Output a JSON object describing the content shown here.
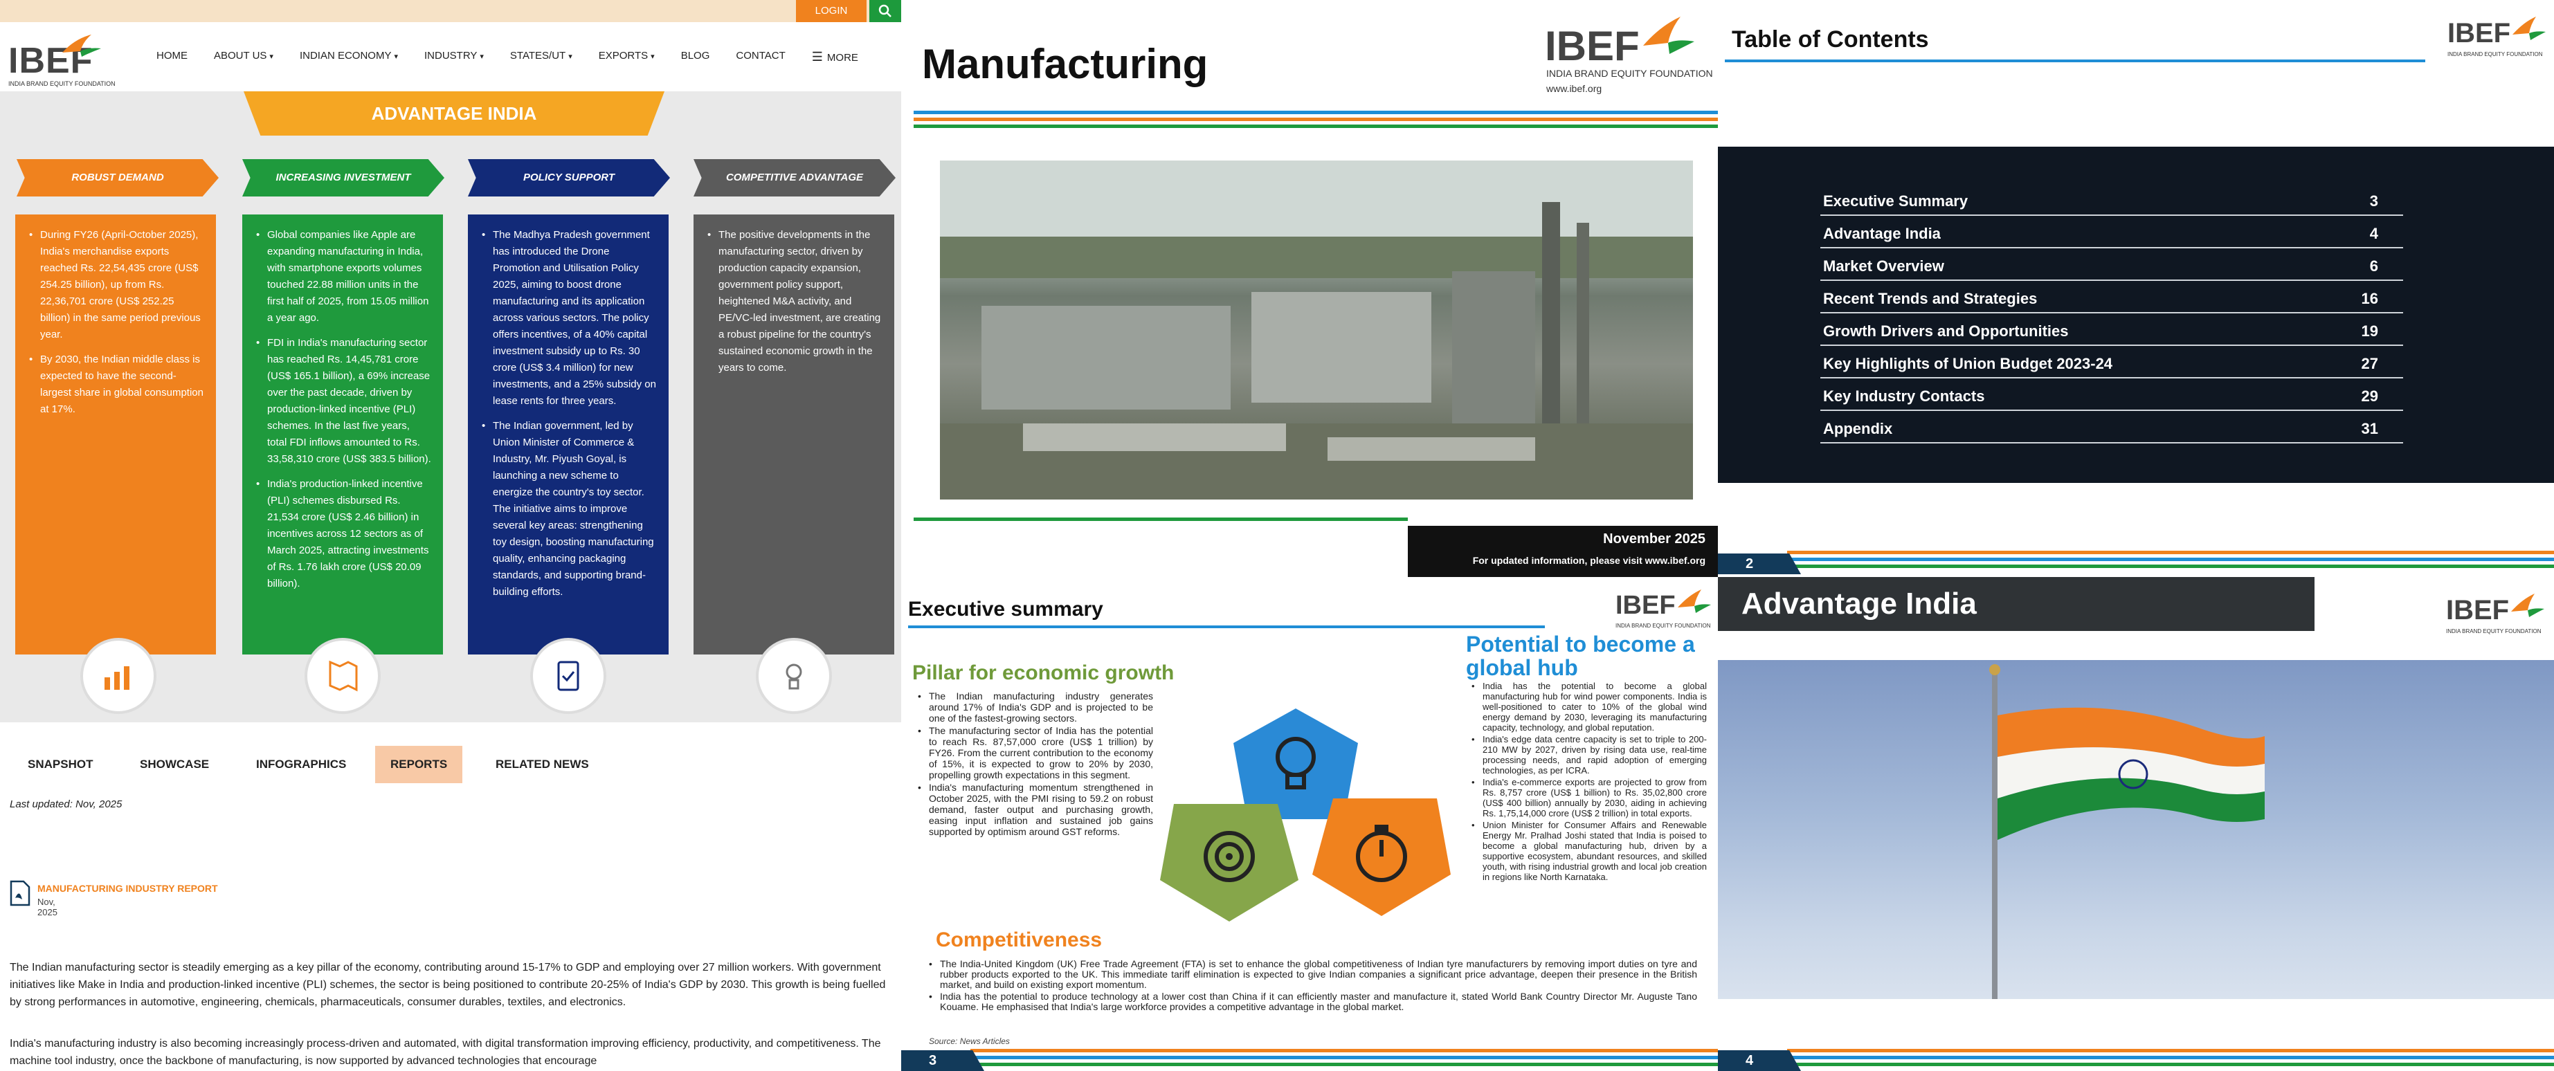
{
  "web": {
    "login_label": "LOGIN",
    "logo_word": "IBEF",
    "logo_sub": "INDIA BRAND EQUITY FOUNDATION",
    "nav": [
      "HOME",
      "ABOUT US",
      "INDIAN ECONOMY",
      "INDUSTRY",
      "STATES/UT",
      "EXPORTS",
      "BLOG",
      "CONTACT",
      "MORE"
    ],
    "banner": "ADVANTAGE INDIA",
    "columns": [
      {
        "tag": "ROBUST DEMAND",
        "color": "#f0821e",
        "bullets": [
          "During FY26 (April-October 2025), India's merchandise exports reached Rs. 22,54,435 crore (US$ 254.25 billion), up from Rs. 22,36,701 crore (US$ 252.25 billion) in the same period previous year.",
          "By 2030, the Indian middle class is expected to have the second-largest share in global consumption at 17%."
        ]
      },
      {
        "tag": "INCREASING INVESTMENT",
        "color": "#1f9a3d",
        "bullets": [
          "Global companies like Apple are expanding manufacturing in India, with smartphone exports volumes touched 22.88 million units in the first half of 2025, from 15.05 million a year ago.",
          "FDI in India's manufacturing sector has reached Rs. 14,45,781 crore (US$ 165.1 billion), a 69% increase over the past decade, driven by production-linked incentive (PLI) schemes. In the last five years, total FDI inflows amounted to Rs. 33,58,310 crore (US$ 383.5 billion).",
          "India's production-linked incentive (PLI) schemes disbursed Rs. 21,534 crore (US$ 2.46 billion) in incentives across 12 sectors as of March 2025, attracting investments of Rs. 1.76 lakh crore (US$ 20.09 billion)."
        ]
      },
      {
        "tag": "POLICY SUPPORT",
        "color": "#122a78",
        "bullets": [
          "The Madhya Pradesh government has introduced the Drone Promotion and Utilisation Policy 2025, aiming to boost drone manufacturing and its application across various sectors. The policy offers incentives, of a 40% capital investment subsidy up to Rs. 30 crore (US$ 3.4 million) for new investments, and a 25% subsidy on lease rents for three years.",
          "The Indian government, led by Union Minister of Commerce & Industry, Mr. Piyush Goyal, is launching a new scheme to energize the country's toy sector. The initiative aims to improve several key areas: strengthening toy design, boosting manufacturing quality, enhancing packaging standards, and supporting brand-building efforts."
        ]
      },
      {
        "tag": "COMPETITIVE ADVANTAGE",
        "color": "#5b5b5b",
        "bullets": [
          "The positive developments in the manufacturing sector, driven by production capacity expansion, government policy support, heightened M&A activity, and PE/VC-led investment, are creating a robust pipeline for the country's sustained economic growth in the years to come."
        ]
      }
    ],
    "tabs": [
      "SNAPSHOT",
      "SHOWCASE",
      "INFOGRAPHICS",
      "REPORTS",
      "RELATED NEWS"
    ],
    "active_tab": "REPORTS",
    "last_updated": "Last updated: Nov, 2025",
    "report_title": "MANUFACTURING INDUSTRY REPORT",
    "report_date": "Nov, 2025",
    "para1": "The Indian manufacturing sector is steadily emerging as a key pillar of the economy, contributing around 15-17% to GDP and employing over 27 million workers. With government initiatives like Make in India and production-linked incentive (PLI) schemes, the sector is being positioned to contribute 20-25% of India's GDP by 2030. This growth is being fuelled by strong performances in automotive, engineering, chemicals, pharmaceuticals, consumer durables, textiles, and electronics.",
    "para2": "India's manufacturing industry is also becoming increasingly process-driven and automated, with digital transformation improving efficiency, productivity, and competitiveness. The machine tool industry, once the backbone of manufacturing, is now supported by advanced technologies that encourage"
  },
  "slide1": {
    "title": "Manufacturing",
    "logo_word": "IBEF",
    "logo_sub": "INDIA BRAND EQUITY FOUNDATION",
    "logo_url": "www.ibef.org",
    "date": "November 2025",
    "updated": "For updated information, please visit www.ibef.org"
  },
  "slide2": {
    "title": "Table of Contents",
    "logo_word": "IBEF",
    "logo_sub": "INDIA BRAND EQUITY FOUNDATION",
    "toc": [
      {
        "label": "Executive Summary",
        "page": "3"
      },
      {
        "label": "Advantage India",
        "page": "4"
      },
      {
        "label": "Market Overview",
        "page": "6"
      },
      {
        "label": "Recent Trends and Strategies",
        "page": "16"
      },
      {
        "label": "Growth Drivers and Opportunities",
        "page": "19"
      },
      {
        "label": "Key Highlights of Union Budget 2023-24",
        "page": "27"
      },
      {
        "label": "Key Industry Contacts",
        "page": "29"
      },
      {
        "label": "Appendix",
        "page": "31"
      }
    ],
    "page_num": "2"
  },
  "slide3": {
    "title": "Executive summary",
    "logo_word": "IBEF",
    "logo_sub": "INDIA BRAND EQUITY FOUNDATION",
    "h_green": "Pillar for economic growth",
    "h_blue": "Potential to become a global hub",
    "h_orange": "Competitiveness",
    "green_bullets": [
      "The Indian manufacturing industry generates around 17% of India's GDP and is projected to be one of the fastest-growing sectors.",
      "The manufacturing sector of India has the potential to reach Rs. 87,57,000 crore (US$ 1 trillion) by FY26. From the current contribution to the economy of 15%, it is expected to grow to 20% by 2030, propelling growth expectations in this segment.",
      "India's manufacturing momentum strengthened in October 2025, with the PMI rising to 59.2 on robust demand, faster output and purchasing growth, easing input inflation and sustained job gains supported by optimism around GST reforms."
    ],
    "blue_bullets": [
      "India has the potential to become a global manufacturing hub for wind power components. India is well-positioned to cater to 10% of the global wind energy demand by 2030, leveraging its manufacturing capacity, technology, and global reputation.",
      "India's edge data centre capacity is set to triple to 200-210 MW by 2027, driven by rising data use, real-time processing needs, and rapid adoption of emerging technologies, as per ICRA.",
      "India's e-commerce exports are projected to grow from Rs. 8,757 crore (US$ 1 billion) to Rs. 35,02,800 crore (US$ 400 billion) annually by 2030, aiding in achieving Rs. 1,75,14,000 crore (US$ 2 trillion) in total exports.",
      "Union Minister for Consumer Affairs and Renewable Energy Mr. Pralhad Joshi stated that India is poised to become a global manufacturing hub, driven by a supportive ecosystem, abundant resources, and skilled youth, with rising industrial growth and local job creation in regions like North Karnataka."
    ],
    "orange_bullets": [
      "The India-United Kingdom (UK) Free Trade Agreement (FTA) is set to enhance the global competitiveness of Indian tyre manufacturers by removing import duties on tyre and rubber products exported to the UK. This immediate tariff elimination is expected to give Indian companies a significant price advantage, deepen their presence in the British market, and build on existing export momentum.",
      "India has the potential to produce technology at a lower cost than China if it can efficiently master and manufacture it, stated World Bank Country Director Mr. Auguste Tano Kouame. He emphasised that India's large workforce provides a competitive advantage in the global market."
    ],
    "source": "Source: News Articles",
    "page_num": "3"
  },
  "slide4": {
    "title": "Advantage India",
    "logo_word": "IBEF",
    "logo_sub": "INDIA BRAND EQUITY FOUNDATION",
    "page_num": "4"
  },
  "colors": {
    "orange": "#f0821e",
    "green": "#1f9a3d",
    "navy": "#122a78",
    "gray": "#5b5b5b",
    "blue": "#1f8ed6"
  }
}
